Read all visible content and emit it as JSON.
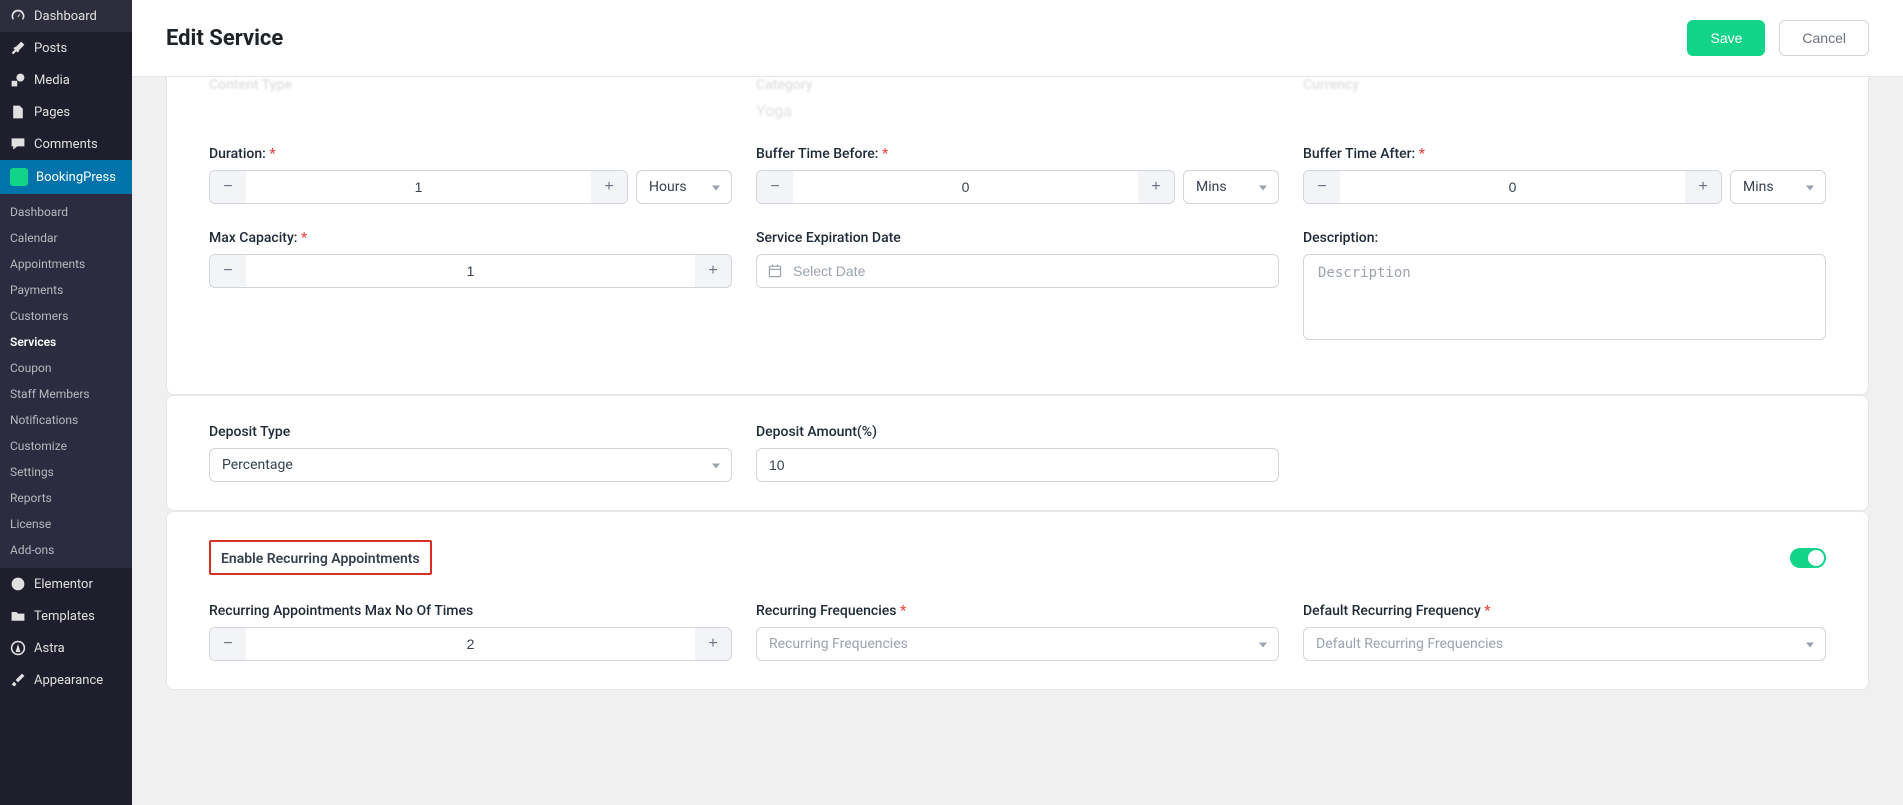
{
  "sidebar": {
    "items": [
      {
        "label": "Dashboard",
        "icon": "gauge-icon"
      },
      {
        "label": "Posts",
        "icon": "pin-icon"
      },
      {
        "label": "Media",
        "icon": "media-icon"
      },
      {
        "label": "Pages",
        "icon": "page-icon"
      },
      {
        "label": "Comments",
        "icon": "comment-icon"
      },
      {
        "label": "BookingPress",
        "icon": "bp-icon"
      },
      {
        "label": "Elementor",
        "icon": "elementor-icon"
      },
      {
        "label": "Templates",
        "icon": "folder-icon"
      },
      {
        "label": "Astra",
        "icon": "astra-icon"
      },
      {
        "label": "Appearance",
        "icon": "brush-icon"
      }
    ],
    "sub": [
      "Dashboard",
      "Calendar",
      "Appointments",
      "Payments",
      "Customers",
      "Services",
      "Coupon",
      "Staff Members",
      "Notifications",
      "Customize",
      "Settings",
      "Reports",
      "License",
      "Add-ons"
    ],
    "sub_active": "Services"
  },
  "header": {
    "title": "Edit Service",
    "save_label": "Save",
    "cancel_label": "Cancel"
  },
  "faded_row": {
    "col1": "Content Type",
    "col2": "Category",
    "col2b": "Yoga",
    "col3": "Currency"
  },
  "fields": {
    "duration": {
      "label": "Duration:",
      "value": "1",
      "unit": "Hours"
    },
    "buffer_before": {
      "label": "Buffer Time Before:",
      "value": "0",
      "unit": "Mins"
    },
    "buffer_after": {
      "label": "Buffer Time After:",
      "value": "0",
      "unit": "Mins"
    },
    "max_capacity": {
      "label": "Max Capacity:",
      "value": "1"
    },
    "expiration": {
      "label": "Service Expiration Date",
      "placeholder": "Select Date"
    },
    "description": {
      "label": "Description:",
      "placeholder": "Description"
    },
    "deposit_type": {
      "label": "Deposit Type",
      "value": "Percentage"
    },
    "deposit_amount": {
      "label": "Deposit Amount(%)",
      "value": "10"
    }
  },
  "recurring": {
    "title": "Enable Recurring Appointments",
    "max_label": "Recurring Appointments Max No Of Times",
    "max_value": "2",
    "freq_label": "Recurring Frequencies",
    "freq_placeholder": "Recurring Frequencies",
    "default_label": "Default Recurring Frequency",
    "default_placeholder": "Default Recurring Frequencies"
  }
}
